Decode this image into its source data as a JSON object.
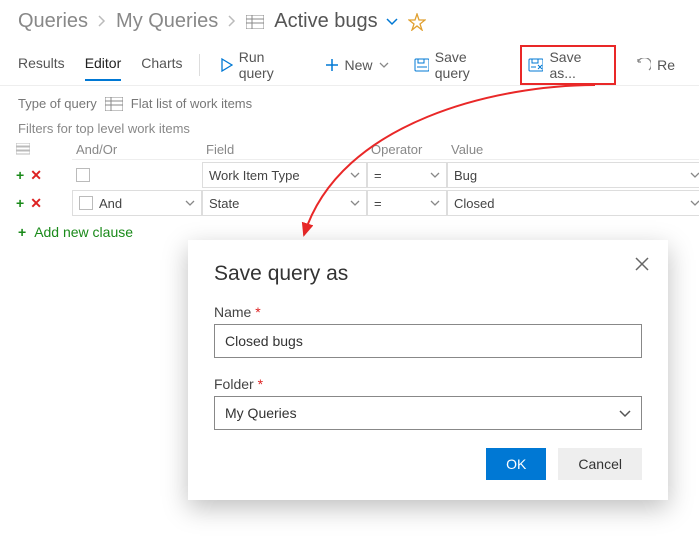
{
  "breadcrumb": {
    "root": "Queries",
    "mid": "My Queries",
    "title": "Active bugs"
  },
  "tabs": {
    "results": "Results",
    "editor": "Editor",
    "charts": "Charts"
  },
  "toolbar": {
    "run": "Run query",
    "new": "New",
    "save": "Save query",
    "saveas": "Save as...",
    "re": "Re"
  },
  "typeq": {
    "label": "Type of query",
    "value": "Flat list of work items"
  },
  "filters": {
    "heading": "Filters for top level work items",
    "cols": {
      "andor": "And/Or",
      "field": "Field",
      "operator": "Operator",
      "value": "Value"
    },
    "rows": [
      {
        "andor": "",
        "field": "Work Item Type",
        "op": "=",
        "value": "Bug"
      },
      {
        "andor": "And",
        "field": "State",
        "op": "=",
        "value": "Closed"
      }
    ],
    "add": "Add new clause"
  },
  "dialog": {
    "title": "Save query as",
    "name_label": "Name",
    "name_value": "Closed bugs",
    "folder_label": "Folder",
    "folder_value": "My Queries",
    "ok": "OK",
    "cancel": "Cancel"
  }
}
